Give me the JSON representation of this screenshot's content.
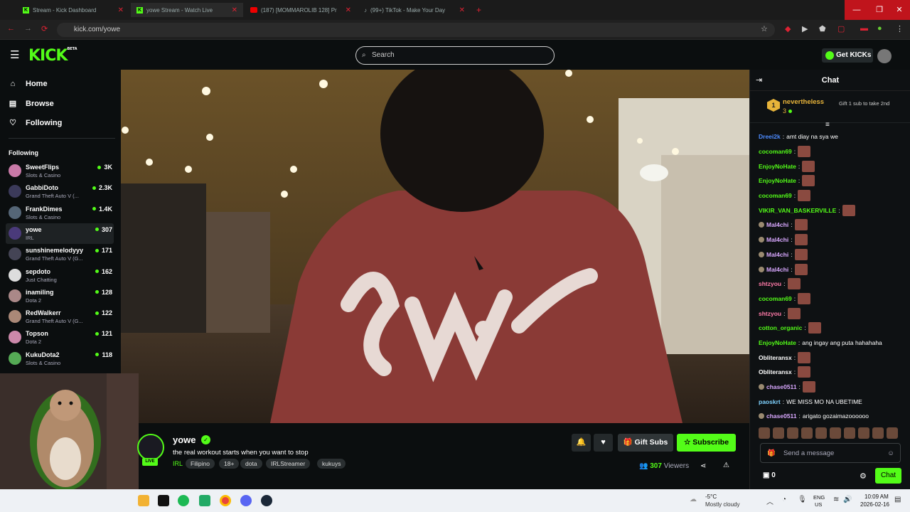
{
  "tabs": [
    {
      "label": "Stream - Kick Dashboard",
      "fav": "kick"
    },
    {
      "label": "yowe Stream - Watch Live",
      "fav": "kick"
    },
    {
      "label": "(187) [MOMMAROLIB 128] Pr",
      "fav": "youtube"
    },
    {
      "label": "(99+) TikTok - Make Your Day",
      "fav": "tiktok"
    }
  ],
  "window_controls": {
    "minimize": "—",
    "maximize": "❐",
    "close": "✕"
  },
  "address": {
    "url": "kick.com/yowe"
  },
  "header": {
    "logo": "KICK",
    "logo_sup": "BETA",
    "search_placeholder": "Search",
    "get_kicks": "Get KICKs"
  },
  "sidebar": {
    "nav": [
      {
        "label": "Home",
        "icon": "⌂"
      },
      {
        "label": "Browse",
        "icon": "▤"
      },
      {
        "label": "Following",
        "icon": "♡"
      }
    ],
    "following_title": "Following",
    "following": [
      {
        "name": "SweetFlips",
        "game": "Slots & Casino",
        "viewers": "3K",
        "color": "#c97aa8"
      },
      {
        "name": "GabbiDoto",
        "game": "Grand Theft Auto V (...",
        "viewers": "2.3K",
        "color": "#3b3a5a"
      },
      {
        "name": "FrankDimes",
        "game": "Slots & Casino",
        "viewers": "1.4K",
        "color": "#556677"
      },
      {
        "name": "yowe",
        "game": "IRL",
        "viewers": "307",
        "color": "#4a3a7a",
        "active": true
      },
      {
        "name": "sunshinemelodyyy",
        "game": "Grand Theft Auto V (G...",
        "viewers": "171",
        "color": "#445"
      },
      {
        "name": "sepdoto",
        "game": "Just Chatting",
        "viewers": "162",
        "color": "#ddd"
      },
      {
        "name": "inamiling",
        "game": "Dota 2",
        "viewers": "128",
        "color": "#a88"
      },
      {
        "name": "RedWalkerr",
        "game": "Grand Theft Auto V (G...",
        "viewers": "122",
        "color": "#a87"
      },
      {
        "name": "Topson",
        "game": "Dota 2",
        "viewers": "121",
        "color": "#c8a"
      },
      {
        "name": "KukuDota2",
        "game": "Slots & Casino",
        "viewers": "118",
        "color": "#5a5"
      }
    ]
  },
  "stream": {
    "channel": "yowe",
    "live": "LIVE",
    "title": "the real workout starts when you want to stop",
    "category": "IRL",
    "tags": [
      "Filipino",
      "18+",
      "dota",
      "IRLStreamer",
      "kukuys"
    ],
    "gift_subs": "Gift Subs",
    "subscribe": "Subscribe",
    "viewers": "307",
    "viewers_label": "Viewers"
  },
  "chat": {
    "title": "Chat",
    "pinned": {
      "rank": "1",
      "name": "nevertheless",
      "count": "3",
      "note": "Gift 1 sub to take 2nd"
    },
    "messages": [
      {
        "user": "Dreei2k",
        "color": "#4d8bff",
        "text": "amt diay na sya we",
        "emote": false
      },
      {
        "user": "cocoman69",
        "color": "#53fc18",
        "text": "",
        "emote": true
      },
      {
        "user": "EnjoyNoHate",
        "color": "#53fc18",
        "text": "",
        "emote": true
      },
      {
        "user": "EnjoyNoHate",
        "color": "#53fc18",
        "text": "",
        "emote": true
      },
      {
        "user": "cocoman69",
        "color": "#53fc18",
        "text": "",
        "emote": true
      },
      {
        "user": "VIKIR_VAN_BASKERVILLE",
        "color": "#53fc18",
        "text": "",
        "emote": true
      },
      {
        "user": "Mal4chi",
        "color": "#d9a8ff",
        "text": "",
        "emote": true,
        "badge": true
      },
      {
        "user": "Mal4chi",
        "color": "#d9a8ff",
        "text": "",
        "emote": true,
        "badge": true
      },
      {
        "user": "Mal4chi",
        "color": "#d9a8ff",
        "text": "",
        "emote": true,
        "badge": true
      },
      {
        "user": "Mal4chi",
        "color": "#d9a8ff",
        "text": "",
        "emote": true,
        "badge": true
      },
      {
        "user": "shtzyou",
        "color": "#ff7aa8",
        "text": "",
        "emote": true
      },
      {
        "user": "cocoman69",
        "color": "#53fc18",
        "text": "",
        "emote": true
      },
      {
        "user": "shtzyou",
        "color": "#ff7aa8",
        "text": "",
        "emote": true
      },
      {
        "user": "cotton_organic",
        "color": "#53fc18",
        "text": "",
        "emote": true
      },
      {
        "user": "EnjoyNoHate",
        "color": "#53fc18",
        "text": "ang ingay ang puta hahahaha",
        "emote": false
      },
      {
        "user": "Obliteransx",
        "color": "#ffffff",
        "text": "",
        "emote": true
      },
      {
        "user": "Obliteransx",
        "color": "#ffffff",
        "text": "",
        "emote": true
      },
      {
        "user": "chase0511",
        "color": "#d9a8ff",
        "text": "",
        "emote": true,
        "badge": true
      },
      {
        "user": "paoskrt",
        "color": "#7fd3ff",
        "text": "WE MISS MO NA UBETIME",
        "emote": false
      },
      {
        "user": "chase0511",
        "color": "#d9a8ff",
        "text": "arigato gozaimazoooooo",
        "emote": false,
        "badge": true
      }
    ],
    "send_placeholder": "Send a message",
    "count": "0",
    "chat_button": "Chat"
  },
  "taskbar": {
    "weather_temp": "-5°C",
    "weather_desc": "Mostly cloudy",
    "lang1": "ENG",
    "lang2": "US",
    "time": "10:09 AM",
    "date": "2026-02-16"
  }
}
